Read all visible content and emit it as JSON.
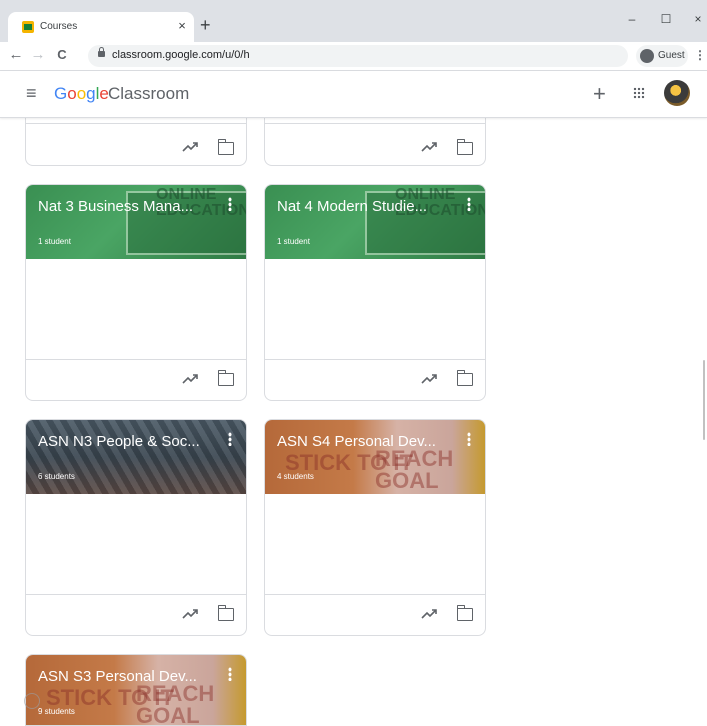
{
  "browser": {
    "tab_title": "Courses",
    "tab_close": "×",
    "new_tab": "+",
    "url": "classroom.google.com/u/0/h",
    "profile_label": "Guest",
    "window_minimize": "–",
    "window_maximize": "☐",
    "window_close": "×",
    "back": "←",
    "forward": "→",
    "reload": "C",
    "menu": "⋮"
  },
  "app": {
    "menu_icon": "≡",
    "logo_word": "Google",
    "product_name": "Classroom",
    "create_join": "+"
  },
  "courses": [
    {
      "title": "Nat 3 Business Mana...",
      "students": "1 student",
      "theme": "green",
      "board_text": "ONLINE EDUCATION"
    },
    {
      "title": "Nat 4 Modern Studie...",
      "students": "1 student",
      "theme": "green",
      "board_text": "ONLINE EDUCATION"
    },
    {
      "title": "ASN N3 People & Soc...",
      "students": "6 students",
      "theme": "crowd"
    },
    {
      "title": "ASN S4 Personal Dev...",
      "students": "4 students",
      "theme": "signs",
      "sign_text_1": "STICK TO IT",
      "sign_text_2": "REACH GOAL"
    },
    {
      "title": "ASN S3 Personal Dev...",
      "students": "9 students",
      "theme": "signs",
      "sign_text_1": "STICK TO IT",
      "sign_text_2": "REACH GOAL"
    }
  ],
  "icons": {
    "trend": "trending-up-icon",
    "folder": "folder-icon",
    "more": "more-vert-icon"
  }
}
